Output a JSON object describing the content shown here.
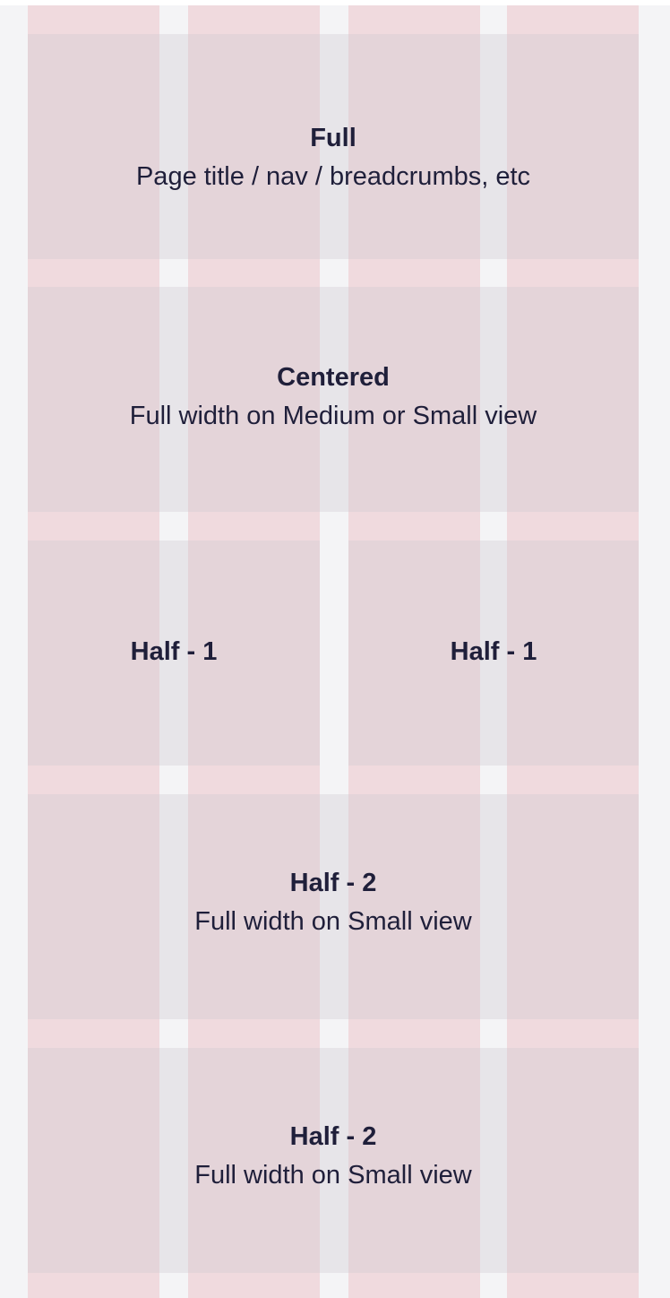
{
  "blocks": {
    "full": {
      "title": "Full",
      "subtitle": "Page title / nav / breadcrumbs, etc"
    },
    "centered": {
      "title": "Centered",
      "subtitle": "Full width on Medium or Small view"
    },
    "half1_left": {
      "title": "Half - 1"
    },
    "half1_right": {
      "title": "Half - 1"
    },
    "half2_first": {
      "title": "Half - 2",
      "subtitle": "Full width on Small view"
    },
    "half2_second": {
      "title": "Half - 2",
      "subtitle": "Full width on Small view"
    }
  },
  "colors": {
    "background": "#f4f4f6",
    "column_overlay": "#e796a2",
    "text": "#1f1f3a"
  }
}
